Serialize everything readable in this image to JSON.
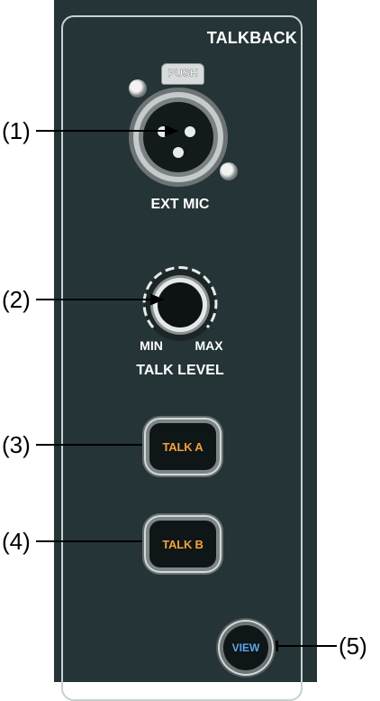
{
  "panel": {
    "section_title": "TALKBACK",
    "ext_mic": {
      "push_label": "PUSH",
      "label": "EXT MIC"
    },
    "talk_level": {
      "min_label": "MIN",
      "max_label": "MAX",
      "label": "TALK LEVEL"
    },
    "talk_a": {
      "label": "TALK A"
    },
    "talk_b": {
      "label": "TALK B"
    },
    "view": {
      "label": "VIEW"
    }
  },
  "callouts": {
    "c1": "(1)",
    "c2": "(2)",
    "c3": "(3)",
    "c4": "(4)",
    "c5": "(5)"
  },
  "colors": {
    "panel_bg": "#243437",
    "talk_button_text": "#f2a23a",
    "view_button_text": "#5aa6e8"
  }
}
